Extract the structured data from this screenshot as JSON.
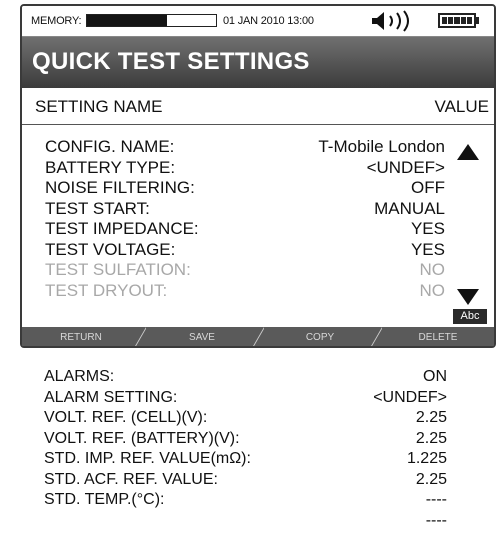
{
  "status": {
    "memory_label": "MEMORY:",
    "memory_usage_fraction": 0.62,
    "datetime": "01 JAN 2010 13:00",
    "sound_icon": "speaker-icon",
    "battery_icon": "battery-icon",
    "battery_level_fraction": 1.0
  },
  "title": "QUICK TEST SETTINGS",
  "header": {
    "name": "SETTING NAME",
    "value": "VALUE"
  },
  "settings": [
    {
      "label": "CONFIG. NAME:",
      "value": "T-Mobile London",
      "enabled": true
    },
    {
      "label": "BATTERY TYPE:",
      "value": "<UNDEF>",
      "enabled": true
    },
    {
      "label": "NOISE FILTERING:",
      "value": "OFF",
      "enabled": true
    },
    {
      "label": "TEST START:",
      "value": "MANUAL",
      "enabled": true
    },
    {
      "label": "TEST IMPEDANCE:",
      "value": "YES",
      "enabled": true
    },
    {
      "label": "TEST VOLTAGE:",
      "value": "YES",
      "enabled": true
    },
    {
      "label": "TEST SULFATION:",
      "value": "NO",
      "enabled": false
    },
    {
      "label": "TEST DRYOUT:",
      "value": "NO",
      "enabled": false
    }
  ],
  "scroll": {
    "up_icon": "scroll-up-arrow-icon",
    "down_icon": "scroll-down-arrow-icon"
  },
  "input_mode": "Abc",
  "softkeys": [
    "RETURN",
    "SAVE",
    "COPY",
    "DELETE"
  ],
  "more_settings": [
    {
      "label": "ALARMS:",
      "value": "ON"
    },
    {
      "label": "ALARM SETTING:",
      "value": "<UNDEF>"
    },
    {
      "label": "VOLT. REF. (CELL)(V):",
      "value": "2.25"
    },
    {
      "label": "VOLT. REF. (BATTERY)(V):",
      "value": "2.25"
    },
    {
      "label": "STD. IMP. REF. VALUE(mΩ):",
      "value": "1.225"
    },
    {
      "label": "STD. ACF. REF. VALUE:",
      "value": "2.25"
    },
    {
      "label": "STD. TEMP.(°C):",
      "value": "----"
    },
    {
      "label": "",
      "value": "----"
    }
  ]
}
